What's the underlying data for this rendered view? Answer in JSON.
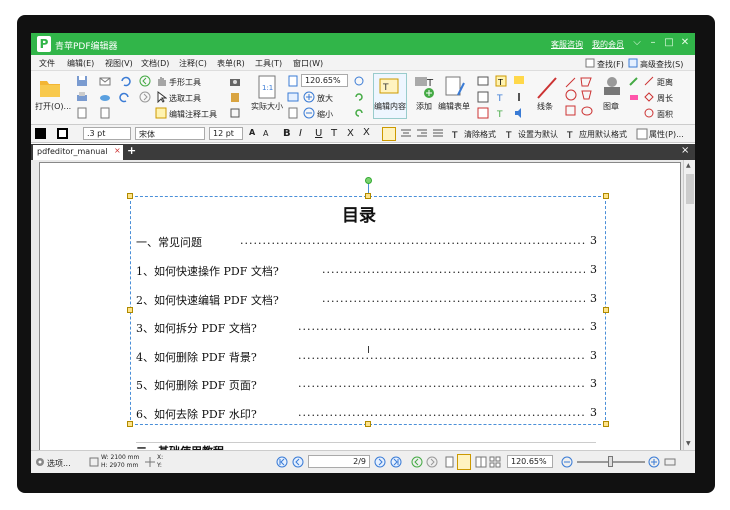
{
  "app": {
    "title": "青苹PDF编辑器",
    "links": [
      "客服咨询",
      "我的会员"
    ],
    "logo": "P"
  },
  "menu": [
    "文件",
    "编辑(E)",
    "视图(V)",
    "文档(D)",
    "注释(C)",
    "表单(R)",
    "工具(T)",
    "窗口(W)"
  ],
  "ribbon": {
    "open": "打开(O)...",
    "hand_tool": "手形工具",
    "select_tool": "选取工具",
    "edit_annot_tool": "编辑注释工具",
    "actual_size": "实际大小",
    "zoom_value": "120.65%",
    "zoom_in": "放大",
    "zoom_out": "缩小",
    "edit_content": "编辑内容",
    "add": "添加",
    "edit_form": "编辑表单",
    "line": "线条",
    "stamp": "图章",
    "find": "查找(F)",
    "adv_find": "高级查找(S)",
    "distance": "距离",
    "perimeter": "周长",
    "area": "面积"
  },
  "format": {
    "stroke_width": ".3 pt",
    "font": "宋体",
    "font_size": "12 pt",
    "clear_format": "清除格式",
    "set_default": "设置为默认",
    "apply_default": "应用默认格式",
    "properties": "属性(P)..."
  },
  "tab": {
    "name": "pdfeditor_manual"
  },
  "document": {
    "title": "目录",
    "entries": [
      {
        "text": "一、常见问题",
        "page": "3"
      },
      {
        "text": "1、如何快速操作  PDF  文档?",
        "page": "3"
      },
      {
        "text": "2、如何快速编辑  PDF  文档?",
        "page": "3"
      },
      {
        "text": "3、如何拆分  PDF  文档?",
        "page": "3"
      },
      {
        "text": "4、如何删除  PDF  背景?",
        "page": "3"
      },
      {
        "text": "5、如何删除  PDF  页面?",
        "page": "3"
      },
      {
        "text": "6、如何去除  PDF  水印?",
        "page": "3"
      }
    ],
    "next_heading": "二、基础使用教程"
  },
  "status": {
    "select": "选项...",
    "w": "W: 2100 mm",
    "h": "H: 2970 mm",
    "x": "X:",
    "y": "Y:",
    "page": "2/9",
    "zoom": "120.65%"
  },
  "colors": {
    "brand": "#31b549",
    "selection": "#4a8fd8",
    "handle": "#ffe48a"
  }
}
